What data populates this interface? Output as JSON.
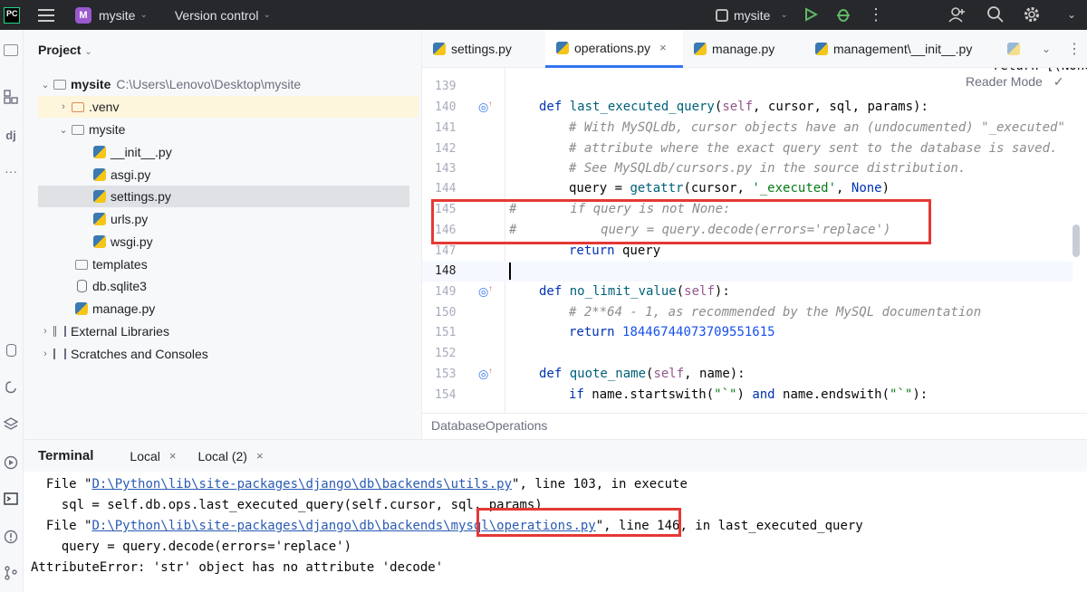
{
  "titlebar": {
    "project_badge": "M",
    "project_name": "mysite",
    "version_control": "Version control",
    "run_config": "mysite"
  },
  "project_panel": {
    "title": "Project",
    "tree": [
      {
        "label": "mysite",
        "path": "C:\\Users\\Lenovo\\Desktop\\mysite"
      },
      {
        "label": ".venv"
      },
      {
        "label": "mysite"
      },
      {
        "label": "__init__.py"
      },
      {
        "label": "asgi.py"
      },
      {
        "label": "settings.py"
      },
      {
        "label": "urls.py"
      },
      {
        "label": "wsgi.py"
      },
      {
        "label": "templates"
      },
      {
        "label": "db.sqlite3"
      },
      {
        "label": "manage.py"
      },
      {
        "label": "External Libraries"
      },
      {
        "label": "Scratches and Consoles"
      }
    ]
  },
  "editor_tabs": [
    "settings.py",
    "operations.py",
    "manage.py",
    "management\\__init__.py"
  ],
  "editor": {
    "reader_mode": "Reader Mode",
    "line_numbers": [
      "139",
      "140",
      "141",
      "142",
      "143",
      "144",
      "145",
      "146",
      "147",
      "148",
      "149",
      "150",
      "151",
      "152",
      "153",
      "154"
    ],
    "breadcrumb": "DatabaseOperations"
  },
  "code": {
    "l140_def": "def ",
    "l140_fn": "last_executed_query",
    "l140_open": "(",
    "l140_self": "self",
    "l140_rest": ", cursor, sql, params):",
    "l141": "# With MySQLdb, cursor objects have an (undocumented) \"_executed\"",
    "l142": "# attribute where the exact query sent to the database is saved.",
    "l143": "# See MySQLdb/cursors.py in the source distribution.",
    "l144_a": "query = ",
    "l144_fn": "getattr",
    "l144_b": "(cursor, ",
    "l144_str": "'_executed'",
    "l144_c": ", ",
    "l144_kw": "None",
    "l144_d": ")",
    "l145": "#       if query is not None:",
    "l146": "#           query = query.decode(errors='replace')",
    "l147_kw": "return",
    "l147_rest": " query",
    "l149_def": "def ",
    "l149_fn": "no_limit_value",
    "l149_open": "(",
    "l149_self": "self",
    "l149_rest": "):",
    "l150": "# 2**64 - 1, as recommended by the MySQL documentation",
    "l151_kw": "return",
    "l151_num": "18446744073709551615",
    "l153_def": "def ",
    "l153_fn": "quote_name",
    "l153_open": "(",
    "l153_self": "self",
    "l153_rest": ", name):",
    "l154_kw": "if",
    "l154_a": " name.startswith(",
    "l154_s1": "\"`\"",
    "l154_b": ") ",
    "l154_and": "and",
    "l154_c": " name.endswith(",
    "l154_s2": "\"`\"",
    "l154_d": "):"
  },
  "terminal": {
    "title": "Terminal",
    "tabs": [
      "Local",
      "Local (2)"
    ],
    "close_glyph": "×",
    "line1_a": "  File \"",
    "line1_link": "D:\\Python\\lib\\site-packages\\django\\db\\backends\\utils.py",
    "line1_b": "\", line 103, in execute",
    "line2": "    sql = self.db.ops.last_executed_query(self.cursor, sql, params)",
    "line3_a": "  File \"",
    "line3_link": "D:\\Python\\lib\\site-packages\\django\\db\\backends\\mysql\\operations.py",
    "line3_b": "\", line 146, in last_executed_query",
    "line4": "    query = query.decode(errors='replace')",
    "line5": "AttributeError: 'str' object has no attribute 'decode'"
  },
  "colors": {
    "accent": "#3574f0",
    "highlight_box": "#e53935",
    "python_blue": "#3b79b2",
    "python_yellow": "#f5c518"
  }
}
